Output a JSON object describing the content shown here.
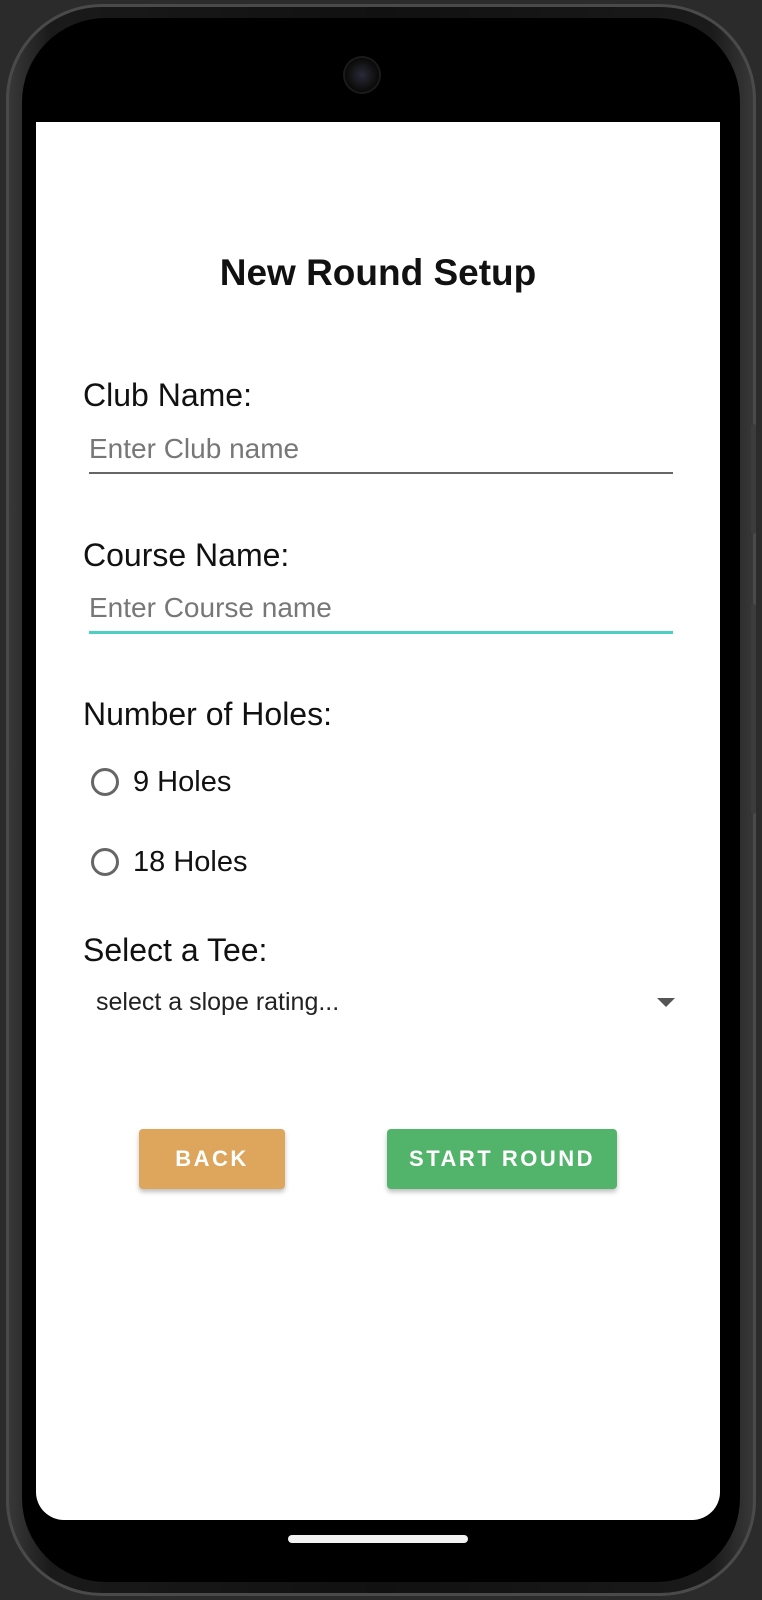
{
  "form": {
    "title": "New Round Setup",
    "club_label": "Club Name:",
    "club_placeholder": "Enter Club name",
    "course_label": "Course Name:",
    "course_placeholder": "Enter Course name",
    "holes_label": "Number of Holes:",
    "holes_options": [
      "9 Holes",
      "18 Holes"
    ],
    "tee_label": "Select a Tee:",
    "tee_selected": "select a slope rating...",
    "back_label": "BACK",
    "start_label": "START ROUND"
  },
  "colors": {
    "back_button": "#dea55c",
    "start_button": "#52b36a",
    "focus_underline": "#4dd0c3"
  }
}
